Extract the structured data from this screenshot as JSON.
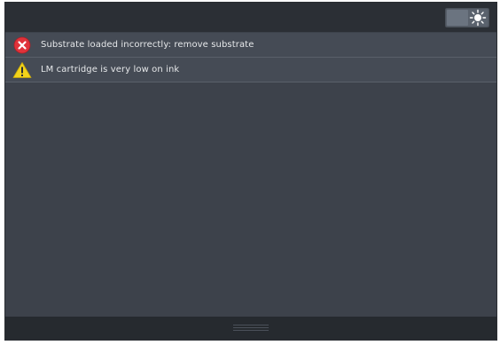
{
  "top_bar": {
    "brightness_toggle_icon": "sun-icon"
  },
  "alerts": [
    {
      "severity": "error",
      "icon": "error-circle-icon",
      "icon_color": "#e0323a",
      "text": "Substrate loaded incorrectly: remove substrate"
    },
    {
      "severity": "warning",
      "icon": "warning-triangle-icon",
      "icon_color": "#f2d31a",
      "text": "LM cartridge is very low on ink"
    }
  ],
  "bottom_bar": {
    "handle_icon": "drag-handle-icon"
  },
  "colors": {
    "background": "#3d424b",
    "top_bar": "#2b2f35",
    "alert_row": "#454b55",
    "text": "#e6e8ea"
  }
}
